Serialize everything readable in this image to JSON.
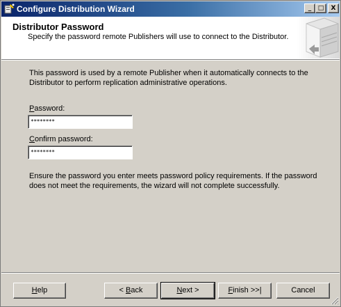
{
  "window": {
    "title": "Configure Distribution Wizard",
    "controls": {
      "minimize": "_",
      "maximize": "□",
      "close": "X"
    }
  },
  "header": {
    "title": "Distributor Password",
    "subtitle": "Specify the password remote Publishers will use to connect to the Distributor."
  },
  "content": {
    "intro_line1": "This password is used by a remote Publisher when it automatically connects to the",
    "intro_line2": "Distributor to perform replication administrative operations.",
    "password_label_accel": "P",
    "password_label_rest": "assword:",
    "password_value": "********",
    "confirm_label_accel": "C",
    "confirm_label_rest": "onfirm password:",
    "confirm_value": "********",
    "note_line1": "Ensure the password you enter meets password policy requirements. If the password",
    "note_line2": "does not meet the requirements, the wizard will not complete successfully."
  },
  "buttons": {
    "help_accel": "H",
    "help_rest": "elp",
    "back_prefix": "< ",
    "back_accel": "B",
    "back_rest": "ack",
    "next_accel": "N",
    "next_rest": "ext >",
    "finish_accel": "F",
    "finish_rest": "inish >>|",
    "cancel": "Cancel"
  },
  "icons": {
    "app": "wizard-app-icon",
    "header_graphic": "server-wizard-graphic",
    "grip": "resize-grip-icon"
  }
}
